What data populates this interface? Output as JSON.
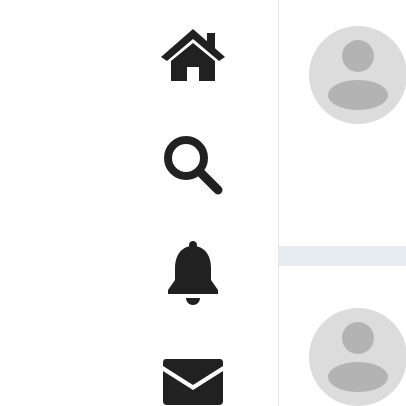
{
  "sidebar": {
    "items": [
      {
        "icon": "home-icon",
        "active": true
      },
      {
        "icon": "search-icon",
        "active": false
      },
      {
        "icon": "bell-icon",
        "active": false
      },
      {
        "icon": "mail-icon",
        "active": false
      }
    ]
  },
  "feed": {
    "posts": [
      {
        "avatar": "default-avatar"
      },
      {
        "avatar": "default-avatar"
      }
    ]
  },
  "colors": {
    "icon": "#212121",
    "divider": "#e6e6e6",
    "separator": "#e6ecf1",
    "avatar_bg": "#dcdcdc",
    "avatar_fg": "#b3b3b3"
  }
}
